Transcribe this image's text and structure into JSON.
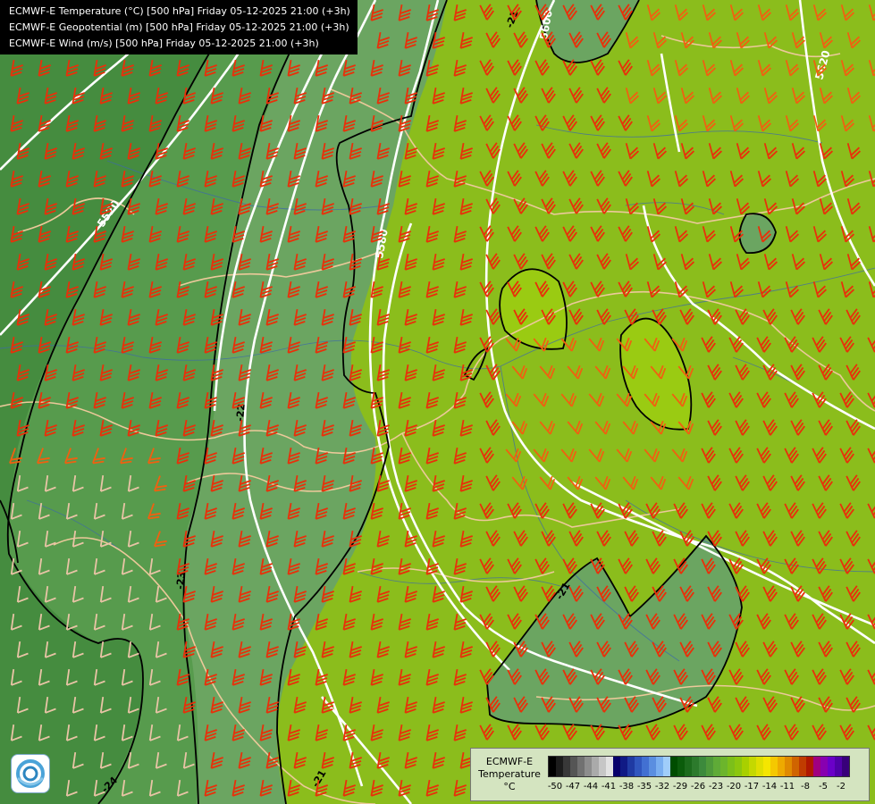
{
  "header": {
    "line1": "ECMWF-E Temperature (°C) [500 hPa] Friday 05-12-2025 21:00 (+3h)",
    "line2": "ECMWF-E Geopotential (m) [500 hPa] Friday 05-12-2025 21:00 (+3h)",
    "line3": "ECMWF-E Wind (m/s) [500 hPa] Friday 05-12-2025 21:00 (+3h)"
  },
  "contour_labels": {
    "geopotential": [
      "5520",
      "5580",
      "5600",
      "5620"
    ],
    "temperature": [
      "-21",
      "-22",
      "-24",
      "-21",
      "-23",
      "-21"
    ]
  },
  "legend": {
    "title_line1": "ECMWF-E",
    "title_line2": "Temperature",
    "unit": "°C",
    "ticks": [
      "-50",
      "-47",
      "-44",
      "-41",
      "-38",
      "-35",
      "-32",
      "-29",
      "-26",
      "-23",
      "-20",
      "-17",
      "-14",
      "-11",
      "-8",
      "-5",
      "-2"
    ],
    "colors": [
      "#000000",
      "#1c1c1c",
      "#383838",
      "#555555",
      "#717171",
      "#8d8d8d",
      "#aaaaaa",
      "#c6c6c6",
      "#e2e2e2",
      "#08006b",
      "#101a85",
      "#1f3aa3",
      "#3056be",
      "#4270d2",
      "#5a8ee0",
      "#79aef0",
      "#a0cdfa",
      "#004d00",
      "#0b5c0b",
      "#1c6b1c",
      "#2c7a2c",
      "#3c8a3c",
      "#4e9a3a",
      "#5fab37",
      "#6cb52c",
      "#7cbf1a",
      "#8cc70e",
      "#a8d000",
      "#c4d800",
      "#dfdf00",
      "#f5e600",
      "#f5c800",
      "#eeaa00",
      "#e08a00",
      "#d06400",
      "#c03c00",
      "#b01800",
      "#a00080",
      "#8800b0",
      "#6a00c8",
      "#5000a8",
      "#38007a"
    ]
  },
  "colors": {
    "dark_green": "#3f8a3c",
    "mid_green": "#5a9e4e",
    "light_green": "#6aa561",
    "lime": "#8bbd1c",
    "wind_strong": "#e8300a",
    "wind_medium": "#f06010",
    "wind_weak": "#e9c4a6",
    "borders": "#ecc99a",
    "rivers": "#3d6aa8"
  }
}
